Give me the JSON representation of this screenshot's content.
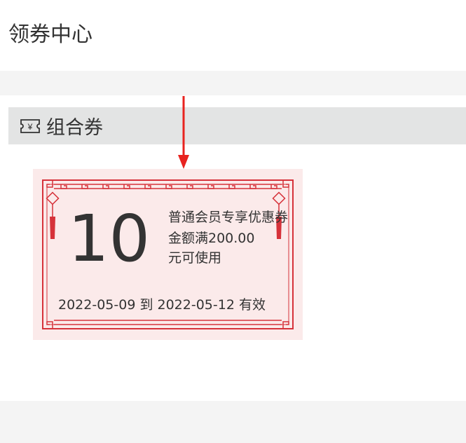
{
  "page": {
    "title": "领券中心"
  },
  "section": {
    "title": "组合券",
    "icon": "ticket-yen-icon"
  },
  "coupon": {
    "amount": "10",
    "name": "普通会员专享优惠券",
    "condition_line1": "金额满200.00",
    "condition_line2": "元可使用",
    "validity": "2022-05-09 到 2022-05-12 有效"
  },
  "colors": {
    "coupon_bg": "#fbeaea",
    "frame_red": "#d6323a",
    "arrow_red": "#e8231f",
    "section_bg": "#e3e4e4",
    "band_gray": "#f4f4f4",
    "text": "#333333"
  }
}
